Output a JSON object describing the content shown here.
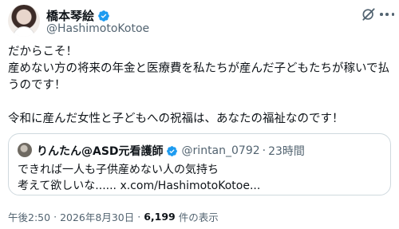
{
  "author": {
    "display_name": "橋本琴絵",
    "handle": "@HashimotoKotoe"
  },
  "tweet": {
    "text": "だからこそ！\n産めない方の将来の年金と医療費を私たちが産んだ子どもたちが稼いで払うのです！\n\n令和に産んだ女性と子どもへの祝福は、あなたの福祉なのです！"
  },
  "quote": {
    "display_name": "りんたん@ASD元看護師",
    "handle": "@rintan_0792",
    "separator": "·",
    "time": "23時間",
    "text": "できれば一人も子供産めない人の気持ち\n考えて欲しいな...... x.com/HashimotoKotoe..."
  },
  "meta": {
    "time": "午後2:50",
    "separator": "·",
    "date": "2026年8月30日",
    "separator2": "·",
    "views_count": "6,199",
    "views_label": "件の表示"
  },
  "icons": {
    "verified": "verified-badge-icon",
    "grok": "grok-icon",
    "more": "more-icon"
  },
  "colors": {
    "verified": "#1d9bf0",
    "text_primary": "#0f1419",
    "text_secondary": "#536471",
    "border": "#cfd9de"
  }
}
